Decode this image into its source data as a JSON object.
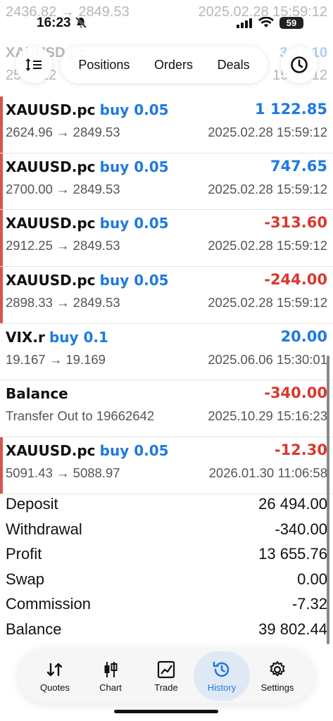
{
  "status_bar": {
    "time": "16:23",
    "battery": "59"
  },
  "ghost_rows": {
    "row1_left": "2436.82 → 2849.53",
    "row1_right": "2025.02.28 15:59:12",
    "row2_left": "XAUUSD.pc",
    "row2_right": "3 3? 10",
    "row3_left": "25??.12",
    "row3_right": "15:59:12"
  },
  "toolbar": {
    "tabs": [
      "Positions",
      "Orders",
      "Deals"
    ]
  },
  "deals": [
    {
      "symbol": "XAUUSD.pc",
      "side": "buy 0.05",
      "profit": "1 122.85",
      "sign": "pos",
      "prices": "2624.96 → 2849.53",
      "time": "2025.02.28 15:59:12"
    },
    {
      "symbol": "XAUUSD.pc",
      "side": "buy 0.05",
      "profit": "747.65",
      "sign": "pos",
      "prices": "2700.00 → 2849.53",
      "time": "2025.02.28 15:59:12"
    },
    {
      "symbol": "XAUUSD.pc",
      "side": "buy 0.05",
      "profit": "-313.60",
      "sign": "neg",
      "prices": "2912.25 → 2849.53",
      "time": "2025.02.28 15:59:12"
    },
    {
      "symbol": "XAUUSD.pc",
      "side": "buy 0.05",
      "profit": "-244.00",
      "sign": "neg",
      "prices": "2898.33 → 2849.53",
      "time": "2025.02.28 15:59:12"
    },
    {
      "symbol": "VIX.r",
      "side": "buy 0.1",
      "profit": "20.00",
      "sign": "pos",
      "prices": "19.167 → 19.169",
      "time": "2025.06.06 15:30:01"
    },
    {
      "symbol": "Balance",
      "side": "",
      "profit": "-340.00",
      "sign": "neg",
      "prices": "Transfer Out to 19662642",
      "time": "2025.10.29 15:16:23"
    },
    {
      "symbol": "XAUUSD.pc",
      "side": "buy 0.05",
      "profit": "-12.30",
      "sign": "neg",
      "prices": "5091.43 → 5088.97",
      "time": "2026.01.30 11:06:58"
    }
  ],
  "summary": [
    {
      "label": "Deposit",
      "value": "26 494.00"
    },
    {
      "label": "Withdrawal",
      "value": "-340.00"
    },
    {
      "label": "Profit",
      "value": "13 655.76"
    },
    {
      "label": "Swap",
      "value": "0.00"
    },
    {
      "label": "Commission",
      "value": "-7.32"
    },
    {
      "label": "Balance",
      "value": "39 802.44"
    }
  ],
  "nav": [
    {
      "label": "Quotes",
      "icon": "quotes-icon"
    },
    {
      "label": "Chart",
      "icon": "chart-icon"
    },
    {
      "label": "Trade",
      "icon": "trade-icon"
    },
    {
      "label": "History",
      "icon": "history-icon",
      "active": true
    },
    {
      "label": "Settings",
      "icon": "settings-icon"
    }
  ],
  "colors": {
    "positive": "#1e7ae0",
    "negative": "#d9382f",
    "stripe": "#d9534f"
  }
}
